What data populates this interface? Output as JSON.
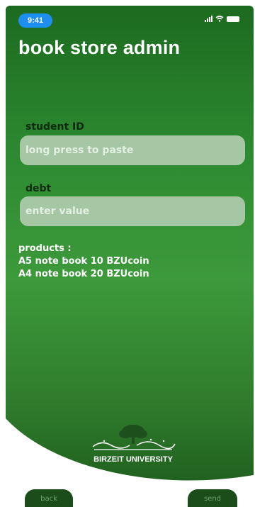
{
  "status": {
    "time": "9:41"
  },
  "header": {
    "title": "book store admin"
  },
  "form": {
    "student_id": {
      "label": "student ID",
      "placeholder": "long press to paste"
    },
    "debt": {
      "label": "debt",
      "placeholder": "enter value"
    }
  },
  "products": {
    "heading": "products :",
    "items": [
      "A5 note book  10 BZUcoin",
      "A4 note book  20 BZUcoin"
    ]
  },
  "logo": {
    "text": "BIRZEIT UNIVERSITY"
  },
  "footer": {
    "back_label": "back",
    "send_label": "send"
  },
  "colors": {
    "accent": "#2d8a31",
    "time_pill": "#1f8ef1",
    "input_bg": "#a6c7a4"
  }
}
